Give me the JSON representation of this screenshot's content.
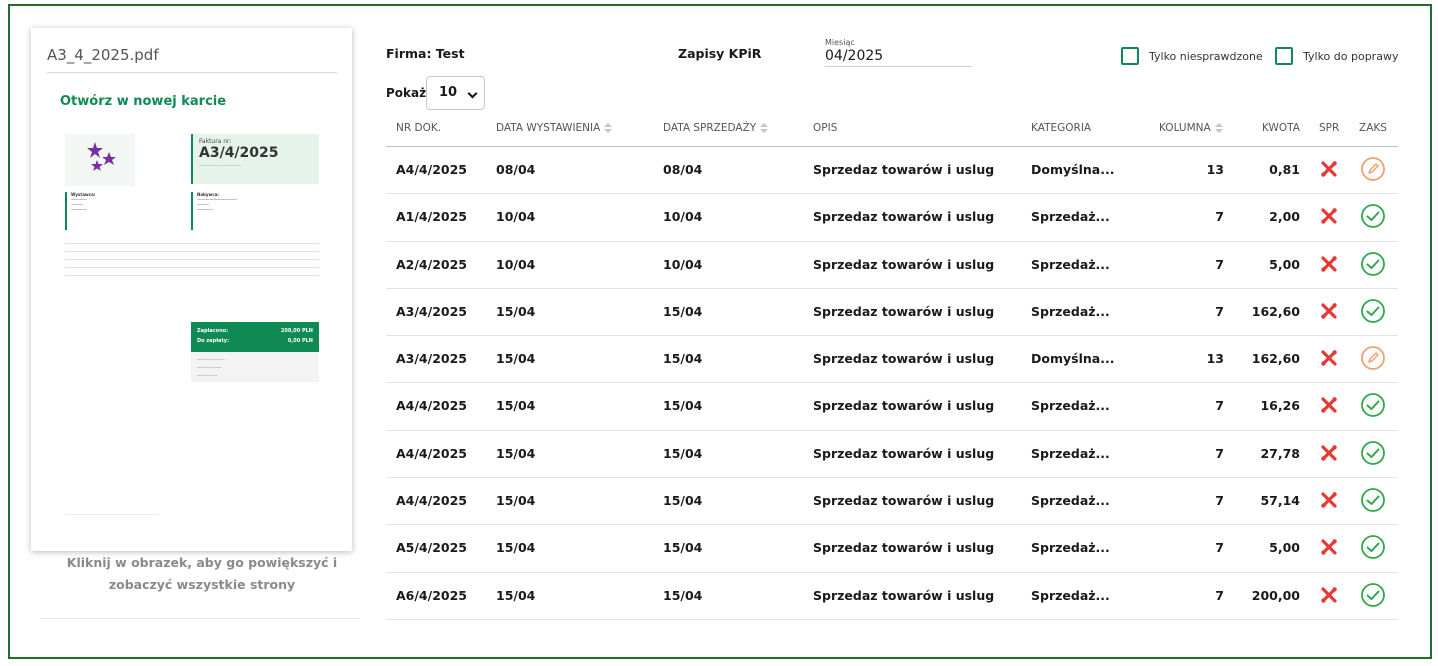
{
  "preview": {
    "file_name": "A3_4_2025.pdf",
    "open_link": "Otwórz w nowej karcie",
    "hint": "Kliknij w obrazek, aby go powiększyć i zobaczyć wszystkie strony",
    "doc": {
      "invoice_label": "Faktura nr:",
      "invoice_number": "A3/4/2025",
      "seller_label": "Wystawca:",
      "buyer_label": "Nabywca:",
      "paid_label": "Zapłacono:",
      "paid_value": "200,00 PLN",
      "due_label": "Do zapłaty:",
      "due_value": "0,00 PLN"
    }
  },
  "header": {
    "firma": "Firma: Test",
    "title": "Zapisy KPiR",
    "month_label": "Miesiąc",
    "month_value": "04/2025",
    "filter_unchecked": "Tylko niesprawdzone",
    "filter_correction": "Tylko do poprawy",
    "pokaz_label": "Pokaż",
    "page_size": "10"
  },
  "columns": {
    "nr": "NR DOK.",
    "data_wyst": "DATA WYSTAWIENIA",
    "data_sprz": "DATA SPRZEDAŻY",
    "opis": "OPIS",
    "kategoria": "KATEGORIA",
    "kolumna": "KOLUMNA",
    "kwota": "KWOTA",
    "spr": "SPR",
    "zaks": "ZAKS"
  },
  "rows": [
    {
      "nr": "A4/4/2025",
      "data_wyst": "08/04",
      "data_sprz": "08/04",
      "opis": "Sprzedaz towarów i uslug",
      "kategoria": "Domyślna...",
      "kolumna": "13",
      "kwota": "0,81",
      "spr_icon": "tools-icon",
      "zaks_status": "edit"
    },
    {
      "nr": "A1/4/2025",
      "data_wyst": "10/04",
      "data_sprz": "10/04",
      "opis": "Sprzedaz towarów i uslug",
      "kategoria": "Sprzedaż...",
      "kolumna": "7",
      "kwota": "2,00",
      "spr_icon": "tools-icon",
      "zaks_status": "ok"
    },
    {
      "nr": "A2/4/2025",
      "data_wyst": "10/04",
      "data_sprz": "10/04",
      "opis": "Sprzedaz towarów i uslug",
      "kategoria": "Sprzedaż...",
      "kolumna": "7",
      "kwota": "5,00",
      "spr_icon": "tools-icon",
      "zaks_status": "ok"
    },
    {
      "nr": "A3/4/2025",
      "data_wyst": "15/04",
      "data_sprz": "15/04",
      "opis": "Sprzedaz towarów i uslug",
      "kategoria": "Sprzedaż...",
      "kolumna": "7",
      "kwota": "162,60",
      "spr_icon": "tools-icon",
      "zaks_status": "ok"
    },
    {
      "nr": "A3/4/2025",
      "data_wyst": "15/04",
      "data_sprz": "15/04",
      "opis": "Sprzedaz towarów i uslug",
      "kategoria": "Domyślna...",
      "kolumna": "13",
      "kwota": "162,60",
      "spr_icon": "tools-icon",
      "zaks_status": "edit"
    },
    {
      "nr": "A4/4/2025",
      "data_wyst": "15/04",
      "data_sprz": "15/04",
      "opis": "Sprzedaz towarów i uslug",
      "kategoria": "Sprzedaż...",
      "kolumna": "7",
      "kwota": "16,26",
      "spr_icon": "tools-icon",
      "zaks_status": "ok"
    },
    {
      "nr": "A4/4/2025",
      "data_wyst": "15/04",
      "data_sprz": "15/04",
      "opis": "Sprzedaz towarów i uslug",
      "kategoria": "Sprzedaż...",
      "kolumna": "7",
      "kwota": "27,78",
      "spr_icon": "tools-icon",
      "zaks_status": "ok"
    },
    {
      "nr": "A4/4/2025",
      "data_wyst": "15/04",
      "data_sprz": "15/04",
      "opis": "Sprzedaz towarów i uslug",
      "kategoria": "Sprzedaż...",
      "kolumna": "7",
      "kwota": "57,14",
      "spr_icon": "tools-icon",
      "zaks_status": "ok"
    },
    {
      "nr": "A5/4/2025",
      "data_wyst": "15/04",
      "data_sprz": "15/04",
      "opis": "Sprzedaz towarów i uslug",
      "kategoria": "Sprzedaż...",
      "kolumna": "7",
      "kwota": "5,00",
      "spr_icon": "tools-icon",
      "zaks_status": "ok"
    },
    {
      "nr": "A6/4/2025",
      "data_wyst": "15/04",
      "data_sprz": "15/04",
      "opis": "Sprzedaz towarów i uslug",
      "kategoria": "Sprzedaż...",
      "kolumna": "7",
      "kwota": "200,00",
      "spr_icon": "tools-icon",
      "zaks_status": "ok"
    }
  ],
  "colors": {
    "frame": "#1f6e2c",
    "accent": "#0f8a55",
    "tools": "#e53935",
    "ok": "#2ea84a",
    "edit": "#f0a070"
  }
}
